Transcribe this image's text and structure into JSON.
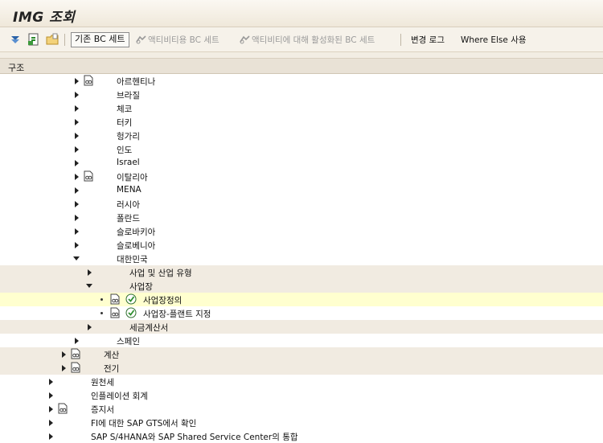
{
  "title": "IMG 조회",
  "toolbar": {
    "bc_set_existing": "기존 BC 세트",
    "bc_set_activity": "액티비티용 BC 세트",
    "bc_set_activated": "액티비티에 대해 활성화된 BC 세트",
    "change_log": "변경 로그",
    "where_used": "Where Else 사용"
  },
  "structure_label": "구조",
  "tree": [
    {
      "label": "아르헨티나",
      "doc": true
    },
    {
      "label": "브라질"
    },
    {
      "label": "체코"
    },
    {
      "label": "터키"
    },
    {
      "label": "헝가리"
    },
    {
      "label": "인도"
    },
    {
      "label": "Israel"
    },
    {
      "label": "이탈리아",
      "doc": true
    },
    {
      "label": "MENA"
    },
    {
      "label": "러시아"
    },
    {
      "label": "폴란드"
    },
    {
      "label": "슬로바키아"
    },
    {
      "label": "슬로베니아"
    },
    {
      "label": "대한민국"
    },
    {
      "label": "사업 및 산업 유형"
    },
    {
      "label": "사업장"
    },
    {
      "label": "사업장정의"
    },
    {
      "label": "사업장-플랜트 지정"
    },
    {
      "label": "세금계산서"
    },
    {
      "label": "스페인"
    },
    {
      "label": "계산"
    },
    {
      "label": "전기"
    },
    {
      "label": "원천세"
    },
    {
      "label": "인플레이션 회계"
    },
    {
      "label": "증지서"
    },
    {
      "label": "FI에 대한 SAP GTS에서 확인"
    },
    {
      "label": "SAP S/4HANA와 SAP Shared Service Center의 통합"
    }
  ]
}
